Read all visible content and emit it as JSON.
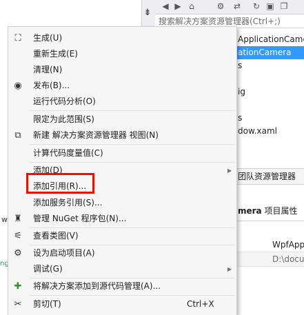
{
  "solution_explorer": {
    "search_placeholder": "搜索解决方案资源管理器(Ctrl+;)",
    "tree": [
      {
        "text": "ApplicationCame",
        "selected": false
      },
      {
        "text": "ationCamera",
        "selected": true
      },
      {
        "text": "s",
        "selected": false
      },
      {
        "text": "",
        "selected": false
      },
      {
        "text": "ig",
        "selected": false
      },
      {
        "text": "",
        "selected": false
      },
      {
        "text": "s",
        "selected": false
      },
      {
        "text": "dow.xaml",
        "selected": false
      }
    ],
    "bottom_tab": "团队资源管理器"
  },
  "properties": {
    "title_bold": "mera",
    "title_rest": "项目属性",
    "rows": [
      "WpfApp",
      "D:\\docu"
    ]
  },
  "edge_text": {
    "w": "w",
    "ng": "ng"
  },
  "context_menu": {
    "items": [
      {
        "icon": "build-icon",
        "label": "生成(U)",
        "shortcut": "",
        "submenu": false
      },
      {
        "icon": "",
        "label": "重新生成(E)",
        "shortcut": "",
        "submenu": false
      },
      {
        "icon": "",
        "label": "清理(N)",
        "shortcut": "",
        "submenu": false
      },
      {
        "icon": "publish-icon",
        "label": "发布(B)...",
        "shortcut": "",
        "submenu": false
      },
      {
        "icon": "",
        "label": "运行代码分析(O)",
        "shortcut": "",
        "submenu": false
      },
      {
        "icon": "",
        "label": "限定为此范围(S)",
        "shortcut": "",
        "submenu": false
      },
      {
        "icon": "new-view-icon",
        "label": "新建 解决方案资源管理器 视图(N)",
        "shortcut": "",
        "submenu": false
      },
      {
        "icon": "",
        "label": "计算代码度量值(C)",
        "shortcut": "",
        "submenu": false
      },
      {
        "icon": "",
        "label": "添加(D)",
        "shortcut": "",
        "submenu": true
      },
      {
        "icon": "",
        "label": "添加引用(R)...",
        "shortcut": "",
        "submenu": false
      },
      {
        "icon": "",
        "label": "添加服务引用(S)...",
        "shortcut": "",
        "submenu": false
      },
      {
        "icon": "nuget-icon",
        "label": "管理 NuGet 程序包(N)...",
        "shortcut": "",
        "submenu": false
      },
      {
        "icon": "class-view-icon",
        "label": "查看类图(V)",
        "shortcut": "",
        "submenu": false
      },
      {
        "icon": "startup-gear-icon",
        "label": "设为启动项目(A)",
        "shortcut": "",
        "submenu": false
      },
      {
        "icon": "",
        "label": "调试(G)",
        "shortcut": "",
        "submenu": true
      },
      {
        "icon": "source-control-icon",
        "label": "将解决方案添加到源代码管理(A)...",
        "shortcut": "",
        "submenu": false
      },
      {
        "icon": "cut-icon",
        "label": "剪切(T)",
        "shortcut": "Ctrl+X",
        "submenu": false
      }
    ],
    "highlight_color": "#e51400"
  }
}
